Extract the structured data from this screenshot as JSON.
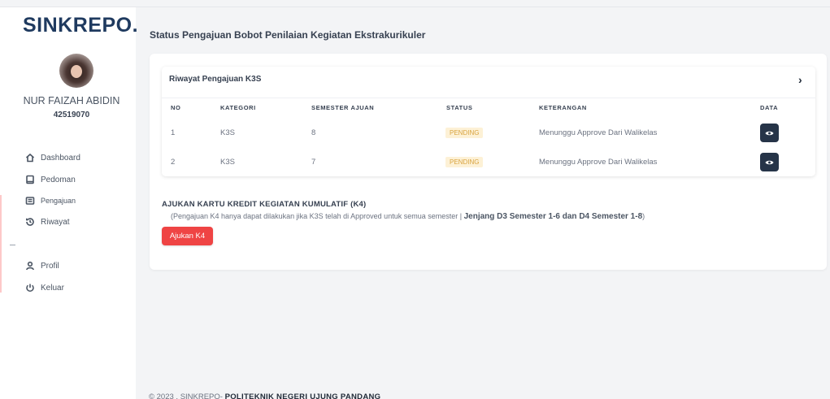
{
  "sidebar": {
    "brand": "SINKREPO.",
    "user_name": "NUR FAIZAH ABIDIN",
    "user_id": "42519070",
    "items": [
      {
        "label": "Dashboard",
        "icon": "home-icon"
      },
      {
        "label": "Pedoman",
        "icon": "book-icon"
      },
      {
        "label": "Pengajuan",
        "icon": "list-icon"
      },
      {
        "label": "Riwayat",
        "icon": "history-icon"
      },
      {
        "label": "Profil",
        "icon": "user-icon"
      },
      {
        "label": "Keluar",
        "icon": "power-icon"
      }
    ]
  },
  "page": {
    "title": "Status Pengajuan Bobot Penilaian Kegiatan Ekstrakurikuler"
  },
  "history": {
    "title": "Riwayat Pengajuan K3S",
    "columns": [
      "NO",
      "KATEGORI",
      "SEMESTER AJUAN",
      "STATUS",
      "KETERANGAN",
      "DATA"
    ],
    "rows": [
      {
        "no": "1",
        "kategori": "K3S",
        "semester": "8",
        "status": "PENDING",
        "keterangan": "Menunggu Approve Dari Walikelas"
      },
      {
        "no": "2",
        "kategori": "K3S",
        "semester": "7",
        "status": "PENDING",
        "keterangan": "Menunggu Approve Dari Walikelas"
      }
    ]
  },
  "k4": {
    "title": "AJUKAN KARTU KREDIT KEGIATAN KUMULATIF (K4)",
    "note": "(Pengajuan K4 hanya dapat dilakukan jika K3S telah di Approved untuk semua semester |",
    "note_bold": "Jenjang D3 Semester 1-6 dan D4 Semester 1-8",
    "note_end": ")",
    "button": "Ajukan K4"
  },
  "footer": {
    "prefix": "© 2023 . SINKREPO-",
    "org": "POLITEKNIK NEGERI UJUNG PANDANG"
  },
  "colors": {
    "brand": "#1f3a5f",
    "danger": "#ef4444",
    "pending_text": "#d9a441",
    "pending_bg": "#fdf1d6",
    "dark_button": "#263448"
  }
}
